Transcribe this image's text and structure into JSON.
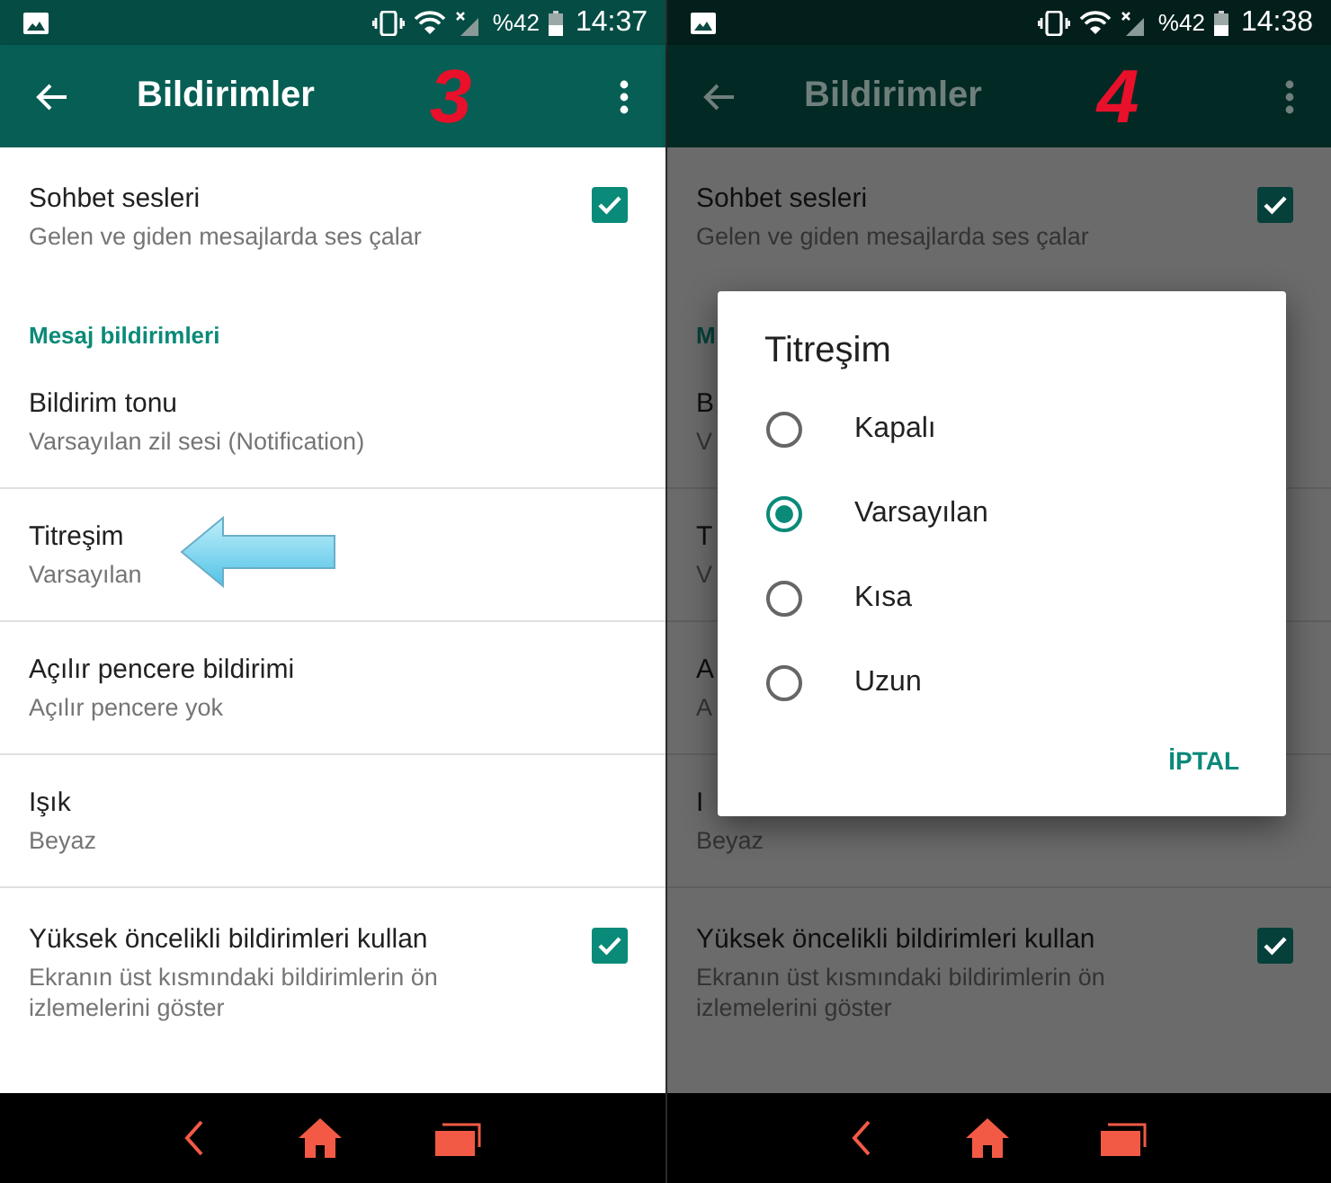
{
  "screens": [
    {
      "dimmed": false,
      "status": {
        "battery": "%42",
        "time": "14:37"
      },
      "title": "Bildirimler",
      "step": "3",
      "annotation": {
        "kind": "arrow"
      },
      "rows": [
        {
          "kind": "check",
          "title": "Sohbet sesleri",
          "subtitle": "Gelen ve giden mesajlarda ses çalar",
          "checked": true
        },
        {
          "kind": "category",
          "title": "Mesaj bildirimleri"
        },
        {
          "kind": "item",
          "title": "Bildirim tonu",
          "subtitle": "Varsayılan zil sesi (Notification)"
        },
        {
          "kind": "item",
          "title": "Titreşim",
          "subtitle": "Varsayılan"
        },
        {
          "kind": "item",
          "title": "Açılır pencere bildirimi",
          "subtitle": "Açılır pencere yok"
        },
        {
          "kind": "item",
          "title": "Işık",
          "subtitle": "Beyaz"
        },
        {
          "kind": "check",
          "title": "Yüksek öncelikli bildirimleri kullan",
          "subtitle": "Ekranın üst kısmındaki bildirimlerin ön izlemelerini göster",
          "checked": true
        }
      ]
    },
    {
      "dimmed": true,
      "status": {
        "battery": "%42",
        "time": "14:38"
      },
      "title": "Bildirimler",
      "step": "4",
      "rows": [
        {
          "kind": "check",
          "title": "Sohbet sesleri",
          "subtitle": "Gelen ve giden mesajlarda ses çalar",
          "checked": true
        },
        {
          "kind": "category",
          "title": "M"
        },
        {
          "kind": "item",
          "title": "B",
          "subtitle": "V"
        },
        {
          "kind": "item",
          "title": "T",
          "subtitle": "V"
        },
        {
          "kind": "item",
          "title": "A",
          "subtitle": "A"
        },
        {
          "kind": "item",
          "title": "I",
          "subtitle": "Beyaz"
        },
        {
          "kind": "check",
          "title": "Yüksek öncelikli bildirimleri kullan",
          "subtitle": "Ekranın üst kısmındaki bildirimlerin ön izlemelerini göster",
          "checked": true
        }
      ],
      "dialog": {
        "title": "Titreşim",
        "options": [
          {
            "label": "Kapalı",
            "selected": false
          },
          {
            "label": "Varsayılan",
            "selected": true
          },
          {
            "label": "Kısa",
            "selected": false
          },
          {
            "label": "Uzun",
            "selected": false
          }
        ],
        "button": "İPTAL"
      }
    }
  ]
}
